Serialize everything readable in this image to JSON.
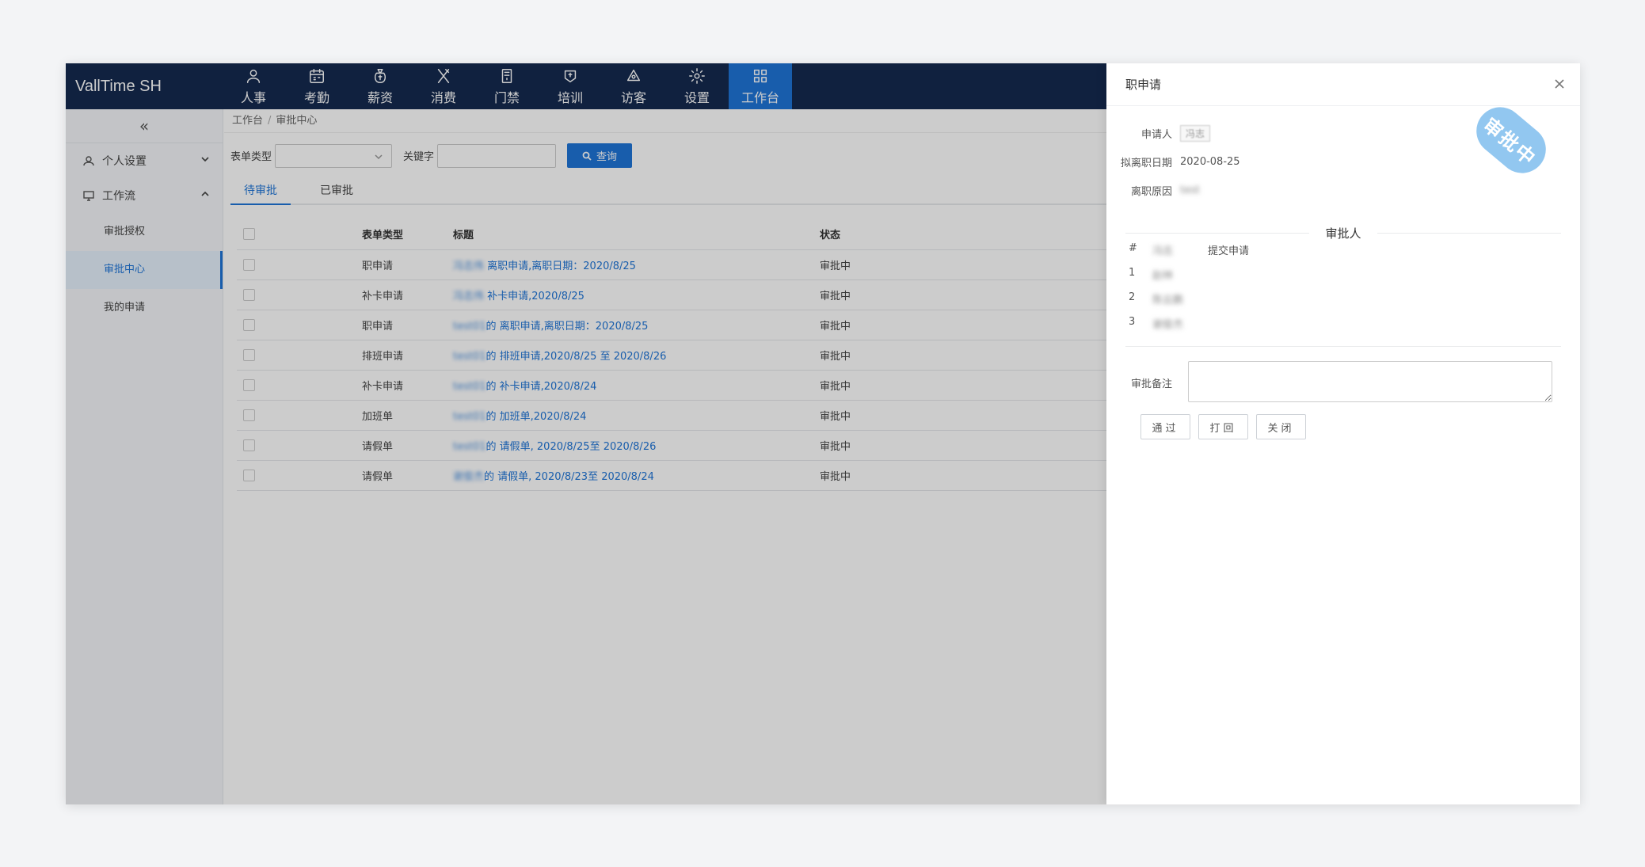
{
  "app": {
    "brand": "VallTime SH"
  },
  "nav": [
    {
      "label": "人事",
      "icon": "user-icon"
    },
    {
      "label": "考勤",
      "icon": "calendar-icon"
    },
    {
      "label": "薪资",
      "icon": "money-bag-icon"
    },
    {
      "label": "消费",
      "icon": "utensils-icon"
    },
    {
      "label": "门禁",
      "icon": "door-icon"
    },
    {
      "label": "培训",
      "icon": "training-icon"
    },
    {
      "label": "访客",
      "icon": "visitor-icon"
    },
    {
      "label": "设置",
      "icon": "gear-icon"
    },
    {
      "label": "工作台",
      "icon": "grid-icon",
      "active": true
    }
  ],
  "sidebar": {
    "collapse_glyph": "«",
    "groups": [
      {
        "label": "个人设置",
        "expanded": false,
        "icon": "user-small-icon"
      },
      {
        "label": "工作流",
        "expanded": true,
        "icon": "monitor-icon",
        "items": [
          {
            "label": "审批授权"
          },
          {
            "label": "审批中心",
            "active": true
          },
          {
            "label": "我的申请"
          }
        ]
      }
    ]
  },
  "breadcrumb": {
    "root": "工作台",
    "current": "审批中心",
    "separator": "/"
  },
  "filter": {
    "form_type_label": "表单类型",
    "form_type_value": "",
    "keyword_label": "关键字",
    "keyword_value": "",
    "search_label": "查询"
  },
  "tabs": [
    {
      "label": "待审批",
      "active": true
    },
    {
      "label": "已审批"
    }
  ],
  "table": {
    "columns": [
      "表单类型",
      "标题",
      "状态"
    ],
    "rows": [
      {
        "type": "职申请",
        "user": "冯志伟",
        "title": " 离职申请,离职日期：2020/8/25",
        "state": "审批中"
      },
      {
        "type": "补卡申请",
        "user": "冯志伟",
        "title": " 补卡申请,2020/8/25",
        "state": "审批中"
      },
      {
        "type": "职申请",
        "user": "test01",
        "title": "的 离职申请,离职日期：2020/8/25",
        "state": "审批中"
      },
      {
        "type": "排班申请",
        "user": "test01",
        "title": "的 排班申请,2020/8/25 至 2020/8/26",
        "state": "审批中"
      },
      {
        "type": "补卡申请",
        "user": "test01",
        "title": "的 补卡申请,2020/8/24",
        "state": "审批中"
      },
      {
        "type": "加班单",
        "user": "test01",
        "title": "的 加班单,2020/8/24",
        "state": "审批中"
      },
      {
        "type": "请假单",
        "user": "test01",
        "title": "的 请假单, 2020/8/25至 2020/8/26",
        "state": "审批中"
      },
      {
        "type": "请假单",
        "user": "谢俊杰",
        "title": "的 请假单, 2020/8/23至 2020/8/24",
        "state": "审批中"
      }
    ]
  },
  "drawer": {
    "title": "职申请",
    "stamp": "审批中",
    "fields": [
      {
        "label": "申请人",
        "value": "冯志"
      },
      {
        "label": "拟离职日期",
        "value": "2020-08-25"
      },
      {
        "label": "离职原因",
        "value": "test"
      }
    ],
    "approver_title": "审批人",
    "approver_header": {
      "num": "#",
      "name": "冯志",
      "action": "提交申请"
    },
    "approvers": [
      {
        "num": "1",
        "name": "赵林"
      },
      {
        "num": "2",
        "name": "陈云鹏"
      },
      {
        "num": "3",
        "name": "谢俊杰"
      }
    ],
    "remark_label": "审批备注",
    "remark_value": "",
    "buttons": {
      "pass": "通过",
      "reject": "打回",
      "close": "关闭"
    }
  }
}
